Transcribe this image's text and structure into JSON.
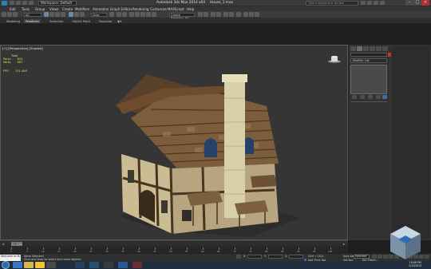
{
  "window": {
    "workspace": "Workspace: Default",
    "app_title": "Autodesk 3ds Max  2014 x64",
    "file_name": "House_1.max",
    "search_placeholder": "Type a keyword or phrase"
  },
  "menu": [
    "Edit",
    "Tools",
    "Group",
    "Views",
    "Create",
    "Modifiers",
    "Animation",
    "Graph Editors",
    "Rendering",
    "Customize",
    "MAXScript",
    "Help"
  ],
  "toolbar": {
    "undo_dropdown": "All",
    "view_dropdown": "View",
    "selection_set": "Create Selection Se"
  },
  "ribbon_tabs": [
    "Modeling",
    "Freeform",
    "Selection",
    "Object Paint",
    "Populate"
  ],
  "ribbon_active": "Freeform",
  "viewport": {
    "label": "[+] [Perspective] [Shaded]",
    "stats_header": "Total",
    "stats": [
      {
        "k": "Polys:",
        "v": "624"
      },
      {
        "k": "Verts:",
        "v": "667"
      }
    ],
    "fps_label": "FPS:",
    "fps_value": "131.449"
  },
  "command_panel": {
    "modifier_list": "Modifier List",
    "swatch_color": "#c42f2f"
  },
  "timeline": {
    "slider_text": "0 / 100",
    "ticks": [
      "0",
      "5",
      "10",
      "15",
      "20",
      "25",
      "30",
      "35",
      "40",
      "45",
      "50",
      "55",
      "60",
      "65",
      "70",
      "75",
      "80",
      "85",
      "90",
      "95",
      "100"
    ]
  },
  "status": {
    "maxscript": "Welcome to M/",
    "line1": "None Selected",
    "line2": "Click and drag to select and move objects",
    "x_label": "X:",
    "y_label": "Y:",
    "z_label": "Z:",
    "grid": "Grid = 10.0",
    "add_time_tag": "Add Time Tag",
    "auto_key": "Auto Key",
    "selected": "Selected",
    "set_key": "Set Key",
    "key_filters": "Key Filters..."
  },
  "taskbar": {
    "clock_time": "10:09 PM",
    "clock_date": "1/13/2015"
  }
}
